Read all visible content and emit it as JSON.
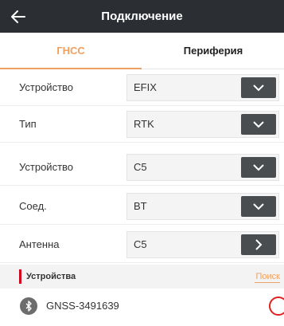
{
  "header": {
    "title": "Подключение",
    "back_icon": "arrow-left-icon"
  },
  "tabs": [
    {
      "label": "ГНСС",
      "active": true
    },
    {
      "label": "Периферия",
      "active": false
    }
  ],
  "form": {
    "rows": [
      {
        "label": "Устройство",
        "value": "EFIX",
        "control": "chevron-down-icon"
      },
      {
        "label": "Тип",
        "value": "RTK",
        "control": "chevron-down-icon"
      },
      {
        "label": "Устройство",
        "value": "C5",
        "control": "chevron-down-icon"
      },
      {
        "label": "Соед.",
        "value": "BT",
        "control": "chevron-down-icon"
      },
      {
        "label": "Антенна",
        "value": "C5",
        "control": "chevron-right-icon"
      }
    ]
  },
  "devices": {
    "title": "Устройства",
    "search_label": "Поиск",
    "items": [
      {
        "name": "GNSS-3491639",
        "icon": "bluetooth-icon",
        "status_icon": "status-ring-icon"
      }
    ]
  },
  "colors": {
    "header_bg": "#2b2f33",
    "accent": "#f0a060",
    "section_marker": "#d0021b",
    "button_bg": "#4a4d50",
    "status": "#e02020"
  }
}
